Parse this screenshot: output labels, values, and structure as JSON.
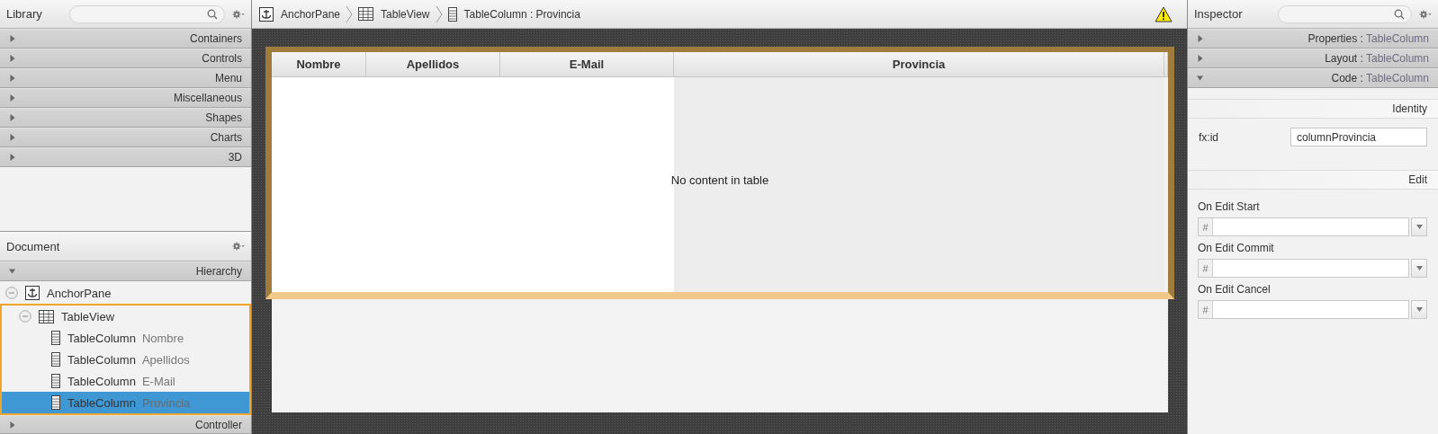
{
  "library": {
    "title": "Library",
    "sections": [
      {
        "label": "Containers",
        "expanded": false
      },
      {
        "label": "Controls",
        "expanded": false
      },
      {
        "label": "Menu",
        "expanded": false
      },
      {
        "label": "Miscellaneous",
        "expanded": false
      },
      {
        "label": "Shapes",
        "expanded": false
      },
      {
        "label": "Charts",
        "expanded": false
      },
      {
        "label": "3D",
        "expanded": false
      }
    ]
  },
  "document": {
    "title": "Document",
    "sections": [
      {
        "label": "Hierarchy",
        "expanded": true
      }
    ],
    "tree": [
      {
        "label": "AnchorPane",
        "kind": "anchor",
        "expanded": true,
        "selected": false,
        "outlined": false,
        "children": [
          {
            "label": "TableView",
            "kind": "table",
            "expanded": true,
            "selected": false,
            "outlined": true,
            "children": [
              {
                "label": "TableColumn",
                "detail": "Nombre",
                "kind": "column",
                "selected": false
              },
              {
                "label": "TableColumn",
                "detail": "Apellidos",
                "kind": "column",
                "selected": false
              },
              {
                "label": "TableColumn",
                "detail": "E-Mail",
                "kind": "column",
                "selected": false
              },
              {
                "label": "TableColumn",
                "detail": "Provincia",
                "kind": "column",
                "selected": true
              }
            ]
          }
        ]
      }
    ],
    "controller": {
      "label": "Controller",
      "expanded": false
    }
  },
  "breadcrumb": [
    {
      "label": "AnchorPane",
      "kind": "anchor"
    },
    {
      "label": "TableView",
      "kind": "table"
    },
    {
      "label": "TableColumn : Provincia",
      "kind": "column"
    }
  ],
  "table": {
    "columns": [
      {
        "label": "Nombre",
        "selected": false
      },
      {
        "label": "Apellidos",
        "selected": false
      },
      {
        "label": "E-Mail",
        "selected": false
      },
      {
        "label": "Provincia",
        "selected": true
      }
    ],
    "empty_text": "No content in table"
  },
  "inspector": {
    "title": "Inspector",
    "sections": [
      {
        "label": "Properties",
        "separator": ":",
        "detail": "TableColumn",
        "expanded": false
      },
      {
        "label": "Layout",
        "separator": ":",
        "detail": "TableColumn",
        "expanded": false
      },
      {
        "label": "Code",
        "separator": ":",
        "detail": "TableColumn",
        "expanded": true
      }
    ],
    "identity": {
      "heading": "Identity",
      "fields": [
        {
          "label": "fx:id",
          "value": "columnProvincia"
        }
      ]
    },
    "edit": {
      "heading": "Edit",
      "handlers": [
        {
          "label": "On Edit Start",
          "prefix": "#"
        },
        {
          "label": "On Edit Commit",
          "prefix": "#"
        },
        {
          "label": "On Edit Cancel",
          "prefix": "#"
        }
      ]
    }
  }
}
